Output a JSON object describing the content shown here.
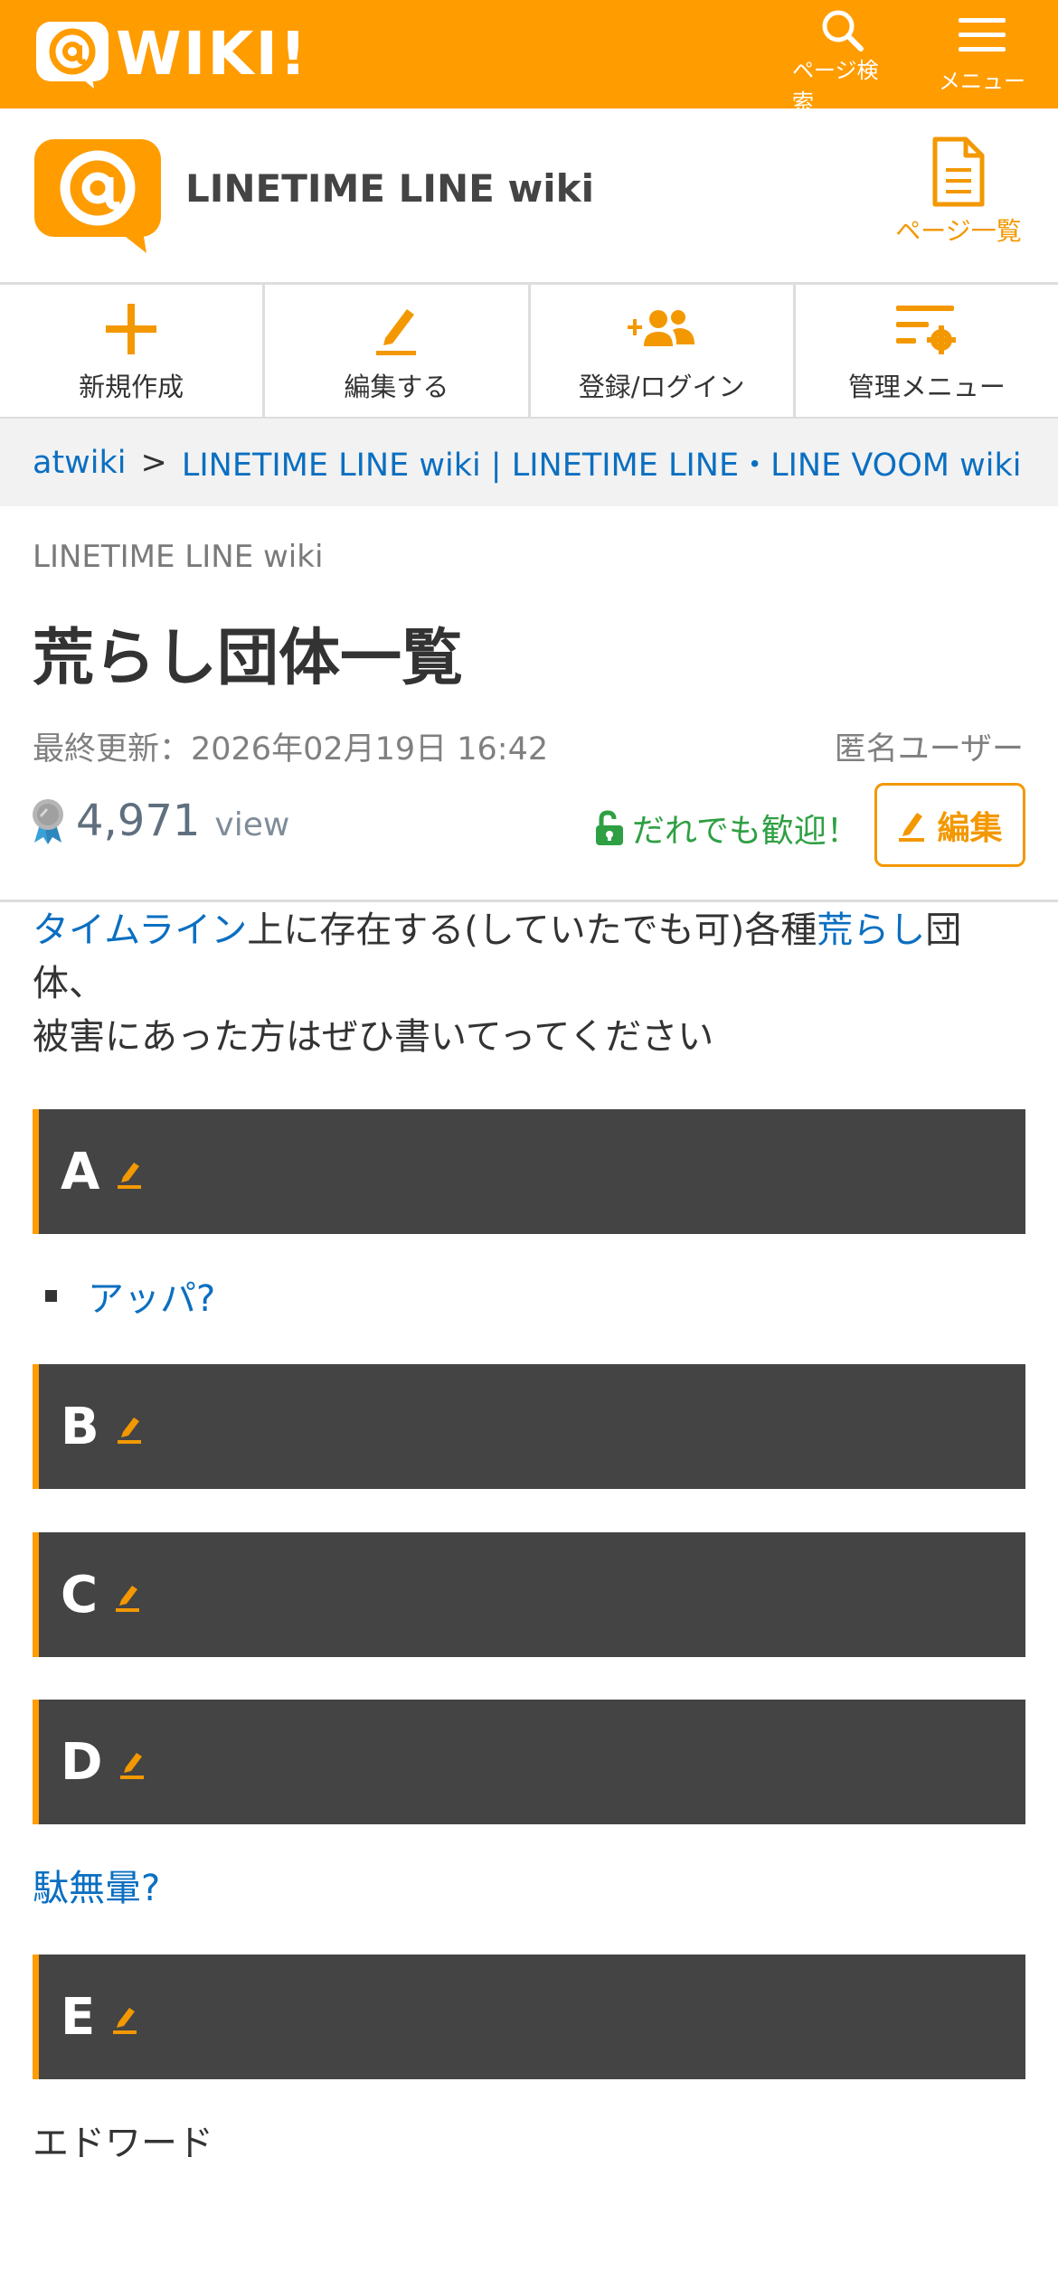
{
  "colors": {
    "brand": "#ff9c00",
    "link": "#0b6fc1",
    "heading_bg": "#444444",
    "welcome": "#2ea043"
  },
  "topbar": {
    "logo_text": "WIKI!",
    "search_label": "ページ検索",
    "menu_label": "メニュー"
  },
  "site": {
    "name": "LINETIME LINE wiki",
    "page_list_label": "ページ一覧"
  },
  "actions": [
    {
      "label": "新規作成",
      "icon": "plus-icon"
    },
    {
      "label": "編集する",
      "icon": "pencil-icon"
    },
    {
      "label": "登録/ログイン",
      "icon": "add-users-icon"
    },
    {
      "label": "管理メニュー",
      "icon": "settings-list-icon"
    }
  ],
  "breadcrumb": {
    "root": "atwiki",
    "separator": ">",
    "current": "LINETIME LINE wiki | LINETIME LINE・LINE VOOM wiki"
  },
  "page": {
    "wiki_name": "LINETIME LINE wiki",
    "title": "荒らし団体一覧",
    "updated": "最終更新：2026年02月19日 16:42",
    "author": "匿名ユーザー",
    "views": "4,971",
    "views_unit": "view",
    "welcome": "だれでも歓迎！",
    "edit_label": "編集"
  },
  "content": {
    "intro_link1": "タイムライン",
    "intro_text1": "上に存在する(していたでも可)各種",
    "intro_link2": "荒らし",
    "intro_text2": "団体、",
    "intro_line2": "被害にあった方はぜひ書いてってください",
    "sections": [
      "A",
      "B",
      "C",
      "D",
      "E"
    ],
    "a_item": "アッパ?",
    "d_link": "駄無暈?",
    "e_text": "エドワード"
  }
}
